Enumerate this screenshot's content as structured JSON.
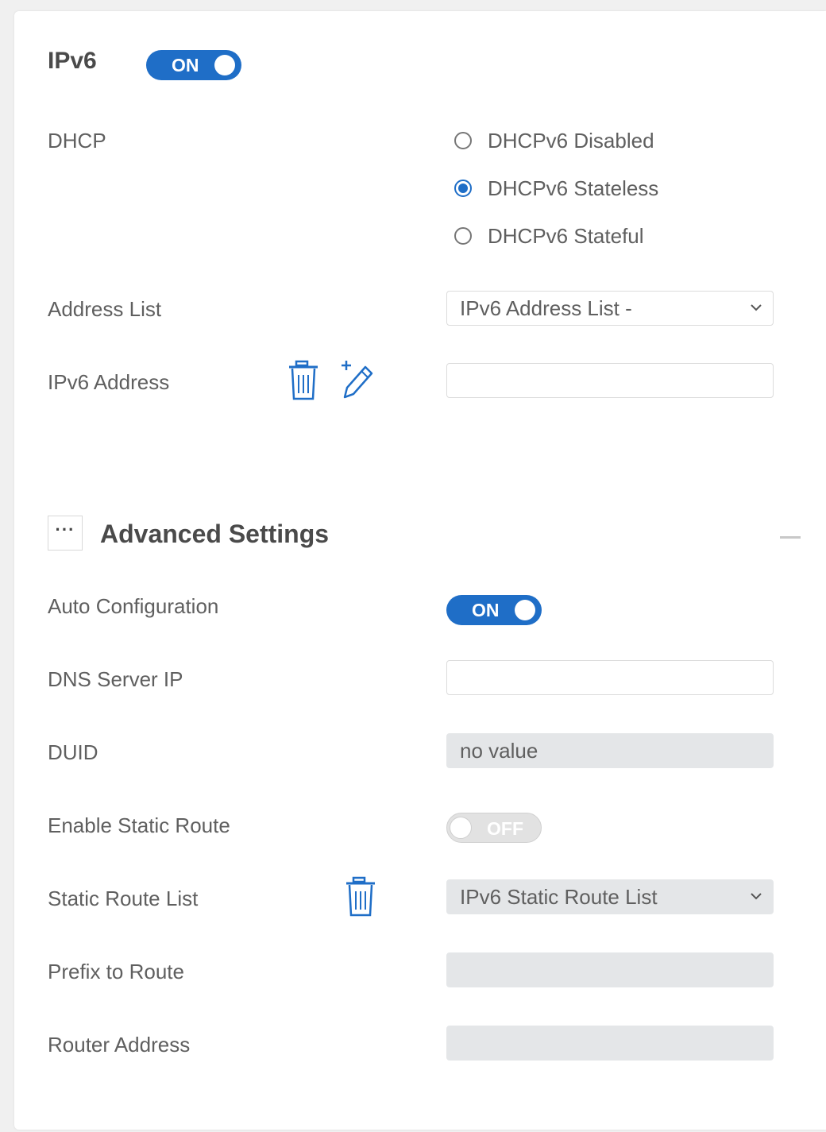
{
  "ipv6": {
    "title": "IPv6",
    "toggle_label": "ON"
  },
  "dhcp": {
    "label": "DHCP",
    "options": [
      {
        "label": "DHCPv6 Disabled",
        "checked": false
      },
      {
        "label": "DHCPv6 Stateless",
        "checked": true
      },
      {
        "label": "DHCPv6 Stateful",
        "checked": false
      }
    ]
  },
  "address_list": {
    "label": "Address List",
    "selected": "IPv6 Address List -"
  },
  "ipv6_address": {
    "label": "IPv6 Address",
    "value": ""
  },
  "advanced": {
    "more_label": "···",
    "title": "Advanced Settings",
    "auto_config": {
      "label": "Auto Configuration",
      "toggle_label": "ON"
    },
    "dns_server": {
      "label": "DNS Server IP",
      "value": ""
    },
    "duid": {
      "label": "DUID",
      "value": "no value"
    },
    "static_route": {
      "label": "Enable Static Route",
      "toggle_label": "OFF"
    },
    "static_route_list": {
      "label": "Static Route List",
      "selected": "IPv6 Static Route List"
    },
    "prefix": {
      "label": "Prefix to Route",
      "value": ""
    },
    "router_address": {
      "label": "Router Address",
      "value": ""
    }
  },
  "colors": {
    "accent": "#1f6ec7",
    "toggle_off": "#e2e2e2",
    "disabled_field": "#e4e6e8"
  },
  "icons": [
    "trash-icon",
    "edit-pencil-icon",
    "chevron-down-icon",
    "more-dots-icon",
    "collapse-icon"
  ]
}
